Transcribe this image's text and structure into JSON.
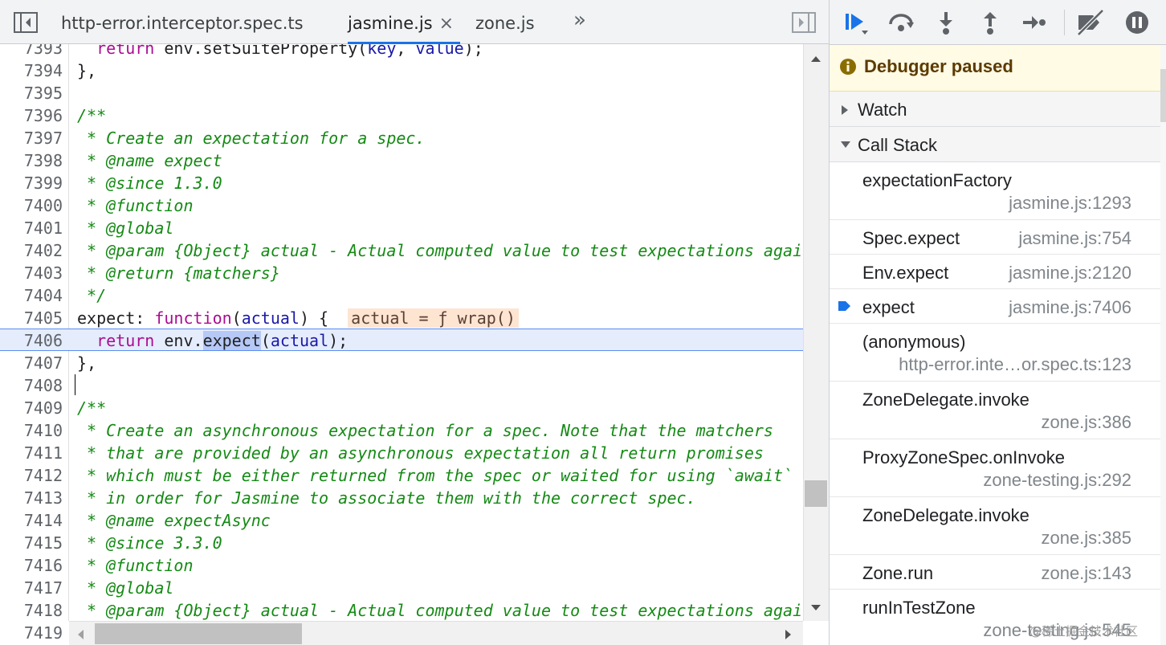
{
  "tabs": [
    {
      "label": "http-error.interceptor.spec.ts",
      "active": false
    },
    {
      "label": "jasmine.js",
      "active": true
    },
    {
      "label": "zone.js",
      "active": false
    }
  ],
  "tab_close_glyph": "×",
  "overflow_glyph": "»",
  "code": {
    "lines": [
      "7393",
      "7394",
      "7395",
      "7396",
      "7397",
      "7398",
      "7399",
      "7400",
      "7401",
      "7402",
      "7403",
      "7404",
      "7405",
      "7406",
      "7407",
      "7408",
      "7409",
      "7410",
      "7411",
      "7412",
      "7413",
      "7414",
      "7415",
      "7416",
      "7417",
      "7418",
      "7419"
    ],
    "l7393": {
      "indent": "  ",
      "kw": "return",
      "rest_a": " env.setSuiteProperty(",
      "v1": "key",
      "sep": ", ",
      "v2": "value",
      "end": ");"
    },
    "l7394": "},",
    "l7396": "/**",
    "l7397": " * Create an expectation for a spec.",
    "l7398": " * @name expect",
    "l7399": " * @since 1.3.0",
    "l7400": " * @function",
    "l7401": " * @global",
    "l7402": " * @param {Object} actual - Actual computed value to test expectations against.",
    "l7403": " * @return {matchers}",
    "l7404": " */",
    "l7405": {
      "a": "expect: ",
      "kw": "function",
      "b": "(",
      "v": "actual",
      "c": ") {",
      "inline": "actual = ƒ wrap()"
    },
    "l7406": {
      "indent": "  ",
      "kw": "return",
      "a": " env.",
      "hl": "expect",
      "b": "(",
      "v": "actual",
      "c": ");"
    },
    "l7407": "},",
    "l7409": "/**",
    "l7410": " * Create an asynchronous expectation for a spec. Note that the matchers",
    "l7411": " * that are provided by an asynchronous expectation all return promises",
    "l7412": " * which must be either returned from the spec or waited for using `await`",
    "l7413": " * in order for Jasmine to associate them with the correct spec.",
    "l7414": " * @name expectAsync",
    "l7415": " * @since 3.3.0",
    "l7416": " * @function",
    "l7417": " * @global",
    "l7418": " * @param {Object} actual - Actual computed value to test expectations against."
  },
  "debugger": {
    "paused_label": "Debugger paused",
    "watch_label": "Watch",
    "callstack_label": "Call Stack",
    "frames": [
      {
        "fn": "expectationFactory",
        "loc": "jasmine.js:1293",
        "two_line": true,
        "current": false
      },
      {
        "fn": "Spec.expect",
        "loc": "jasmine.js:754",
        "two_line": false,
        "current": false
      },
      {
        "fn": "Env.expect",
        "loc": "jasmine.js:2120",
        "two_line": false,
        "current": false
      },
      {
        "fn": "expect",
        "loc": "jasmine.js:7406",
        "two_line": false,
        "current": true
      },
      {
        "fn": "(anonymous)",
        "loc": "http-error.inte…or.spec.ts:123",
        "two_line": true,
        "current": false
      },
      {
        "fn": "ZoneDelegate.invoke",
        "loc": "zone.js:386",
        "two_line": true,
        "current": false
      },
      {
        "fn": "ProxyZoneSpec.onInvoke",
        "loc": "zone-testing.js:292",
        "two_line": true,
        "current": false
      },
      {
        "fn": "ZoneDelegate.invoke",
        "loc": "zone.js:385",
        "two_line": true,
        "current": false
      },
      {
        "fn": "Zone.run",
        "loc": "zone.js:143",
        "two_line": false,
        "current": false
      },
      {
        "fn": "runInTestZone",
        "loc": "zone-testing.js:545",
        "two_line": true,
        "current": false
      }
    ]
  },
  "watermark": "@稀土掘金技术社区",
  "colors": {
    "accent": "#1a73e8",
    "paused_bg": "#fffbe5",
    "exec_line": "#e5ecfc",
    "comment": "#148a14",
    "keyword": "#aa0d91",
    "variable": "#1a1aa6"
  },
  "icons": [
    "toggle-navigator-icon",
    "toggle-debugger-icon",
    "resume-icon",
    "step-over-icon",
    "step-into-icon",
    "step-out-icon",
    "step-icon",
    "deactivate-breakpoints-icon",
    "pause-on-exceptions-icon",
    "info-icon",
    "current-frame-arrow-icon"
  ]
}
